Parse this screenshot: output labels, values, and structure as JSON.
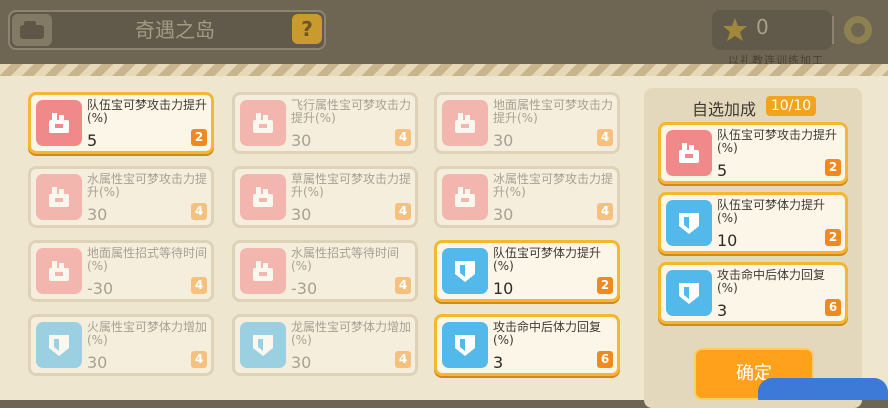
{
  "header": {
    "title": "奇遇之岛",
    "help_label": "?",
    "coin_value": "0",
    "sub_text": "以礼教连训练加工"
  },
  "skills": [
    {
      "name": "队伍宝可梦攻击力提升(%)",
      "value": "5",
      "cost": "2",
      "icon": "attack-icon",
      "selected": true
    },
    {
      "name": "飞行属性宝可梦攻击力提升(%)",
      "value": "30",
      "cost": "4",
      "icon": "attack-icon",
      "selected": false
    },
    {
      "name": "地面属性宝可梦攻击力提升(%)",
      "value": "30",
      "cost": "4",
      "icon": "attack-icon",
      "selected": false
    },
    {
      "name": "水属性宝可梦攻击力提升(%)",
      "value": "30",
      "cost": "4",
      "icon": "attack-icon",
      "selected": false
    },
    {
      "name": "草属性宝可梦攻击力提升(%)",
      "value": "30",
      "cost": "4",
      "icon": "attack-icon",
      "selected": false
    },
    {
      "name": "冰属性宝可梦攻击力提升(%)",
      "value": "30",
      "cost": "4",
      "icon": "attack-icon",
      "selected": false
    },
    {
      "name": "地面属性招式等待时间(%)",
      "value": "-30",
      "cost": "4",
      "icon": "attack-icon",
      "selected": false
    },
    {
      "name": "水属性招式等待时间(%)",
      "value": "-30",
      "cost": "4",
      "icon": "attack-icon",
      "selected": false
    },
    {
      "name": "队伍宝可梦体力提升(%)",
      "value": "10",
      "cost": "2",
      "icon": "shield-icon",
      "selected": true
    },
    {
      "name": "火属性宝可梦体力增加(%)",
      "value": "30",
      "cost": "4",
      "icon": "shield-icon",
      "selected": false
    },
    {
      "name": "龙属性宝可梦体力增加(%)",
      "value": "30",
      "cost": "4",
      "icon": "shield-icon",
      "selected": false
    },
    {
      "name": "攻击命中后体力回复(%)",
      "value": "3",
      "cost": "6",
      "icon": "shield-icon",
      "selected": true
    }
  ],
  "side_panel": {
    "title": "自选加成",
    "count": "10/10",
    "selected": [
      {
        "name": "队伍宝可梦攻击力提升(%)",
        "value": "5",
        "cost": "2",
        "icon": "attack-icon"
      },
      {
        "name": "队伍宝可梦体力提升(%)",
        "value": "10",
        "cost": "2",
        "icon": "shield-icon"
      },
      {
        "name": "攻击命中后体力回复(%)",
        "value": "3",
        "cost": "6",
        "icon": "shield-icon"
      }
    ],
    "confirm_label": "确定"
  }
}
